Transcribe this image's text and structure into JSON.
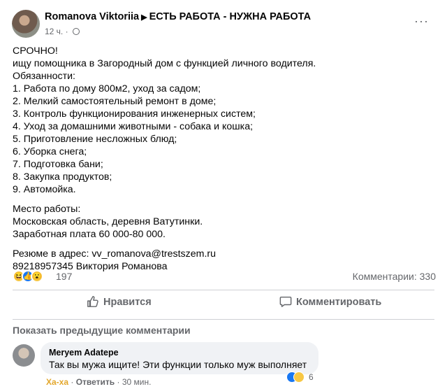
{
  "post": {
    "author": "Romanova Viktoriia",
    "group": "ЕСТЬ РАБОТА - НУЖНА РАБОТА",
    "time": "12 ч.",
    "more": "···",
    "lines": [
      "СРОЧНО!",
      "ищу помощника в Загородный дом с функцией личного водителя.",
      "Обязанности:",
      "1. Работа по дому 800м2, уход за садом;",
      "2. Мелкий самостоятельный ремонт в доме;",
      "3. Контроль функционирования инженерных систем;",
      "4. Уход за домашними животными - собака и кошка;",
      "5. Приготовление несложных блюд;",
      "6. Уборка снега;",
      "7. Подготовка бани;",
      "8. Закупка продуктов;",
      "9. Автомойка."
    ],
    "location_lines": [
      "Место работы:",
      "Московская область, деревня Ватутинки.",
      "Заработная плата 60 000-80 000."
    ],
    "contact_lines": [
      "Резюме в адрес: vv_romanova@trestszem.ru",
      "89218957345 Виктория Романова"
    ],
    "reactions_count": "197",
    "comments_count": "Комментарии: 330"
  },
  "actions": {
    "like": "Нравится",
    "comment": "Комментировать"
  },
  "prev_comments": "Показать предыдущие комментарии",
  "comment": {
    "author": "Meryem Adatepe",
    "text": "Так вы мужа ищите! Эти функции только муж выполняет",
    "reaction_count": "6",
    "haha": "Ха-ха",
    "reply": "Ответить",
    "time": "30 мин."
  },
  "colors": {
    "text": "#050505",
    "secondary": "#65676b",
    "divider": "#ced0d4",
    "bubble": "#f0f2f5",
    "like_blue": "#1877f2",
    "haha_yellow": "#f7c744"
  },
  "icons": [
    "globe-icon",
    "more-icon",
    "haha-reaction-icon",
    "like-reaction-icon",
    "wow-reaction-icon",
    "thumbs-up-icon",
    "comment-icon"
  ]
}
